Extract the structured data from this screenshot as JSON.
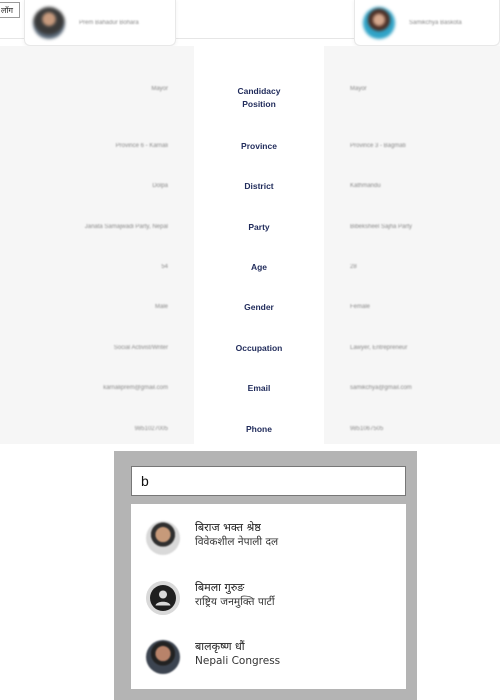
{
  "header": {
    "lang_button": "लॉग",
    "left_candidate": {
      "name": "Prem Bahadur Bohara"
    },
    "right_candidate": {
      "name": "Samikchya Baskota"
    }
  },
  "comparison": {
    "rows": [
      {
        "label": "Candidacy Position",
        "left": "Mayor",
        "right": "Mayor"
      },
      {
        "label": "Province",
        "left": "Province 6 - Karnali",
        "right": "Province 3 - Bagmati"
      },
      {
        "label": "District",
        "left": "Dolpa",
        "right": "Kathmandu"
      },
      {
        "label": "Party",
        "left": "Janata Samajwadi Party, Nepal",
        "right": "Bibeksheel Sajha Party"
      },
      {
        "label": "Age",
        "left": "54",
        "right": "28"
      },
      {
        "label": "Gender",
        "left": "Male",
        "right": "Female"
      },
      {
        "label": "Occupation",
        "left": "Social Activist/Writer",
        "right": "Lawyer, Entrepreneur"
      },
      {
        "label": "Email",
        "left": "karnaliprem@gmail.com",
        "right": "samikchya@gmail.com"
      },
      {
        "label": "Phone",
        "left": "9851027005",
        "right": "9851067505"
      }
    ]
  },
  "search": {
    "query": "b",
    "results": [
      {
        "name": "बिराज भक्त श्रेष्ठ",
        "party": "विवेकशील नेपाली दल",
        "avatar": "photo"
      },
      {
        "name": "बिमला गुरुङ",
        "party": "राष्ट्रिय जनमुक्ति पार्टी",
        "avatar": "default-person-icon"
      },
      {
        "name": "बालकृष्ण धौं",
        "party": "Nepali Congress",
        "avatar": "photo"
      }
    ]
  }
}
